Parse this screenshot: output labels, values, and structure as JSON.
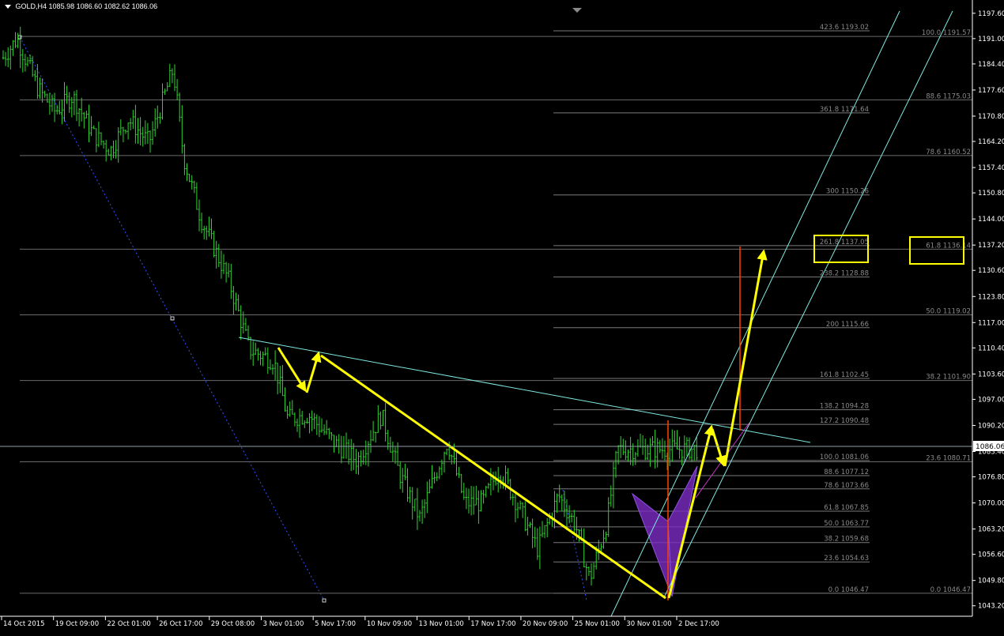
{
  "header": {
    "symbol": "GOLD,H4",
    "ohlc": "1085.98 1086.60 1082.62 1086.06"
  },
  "colors": {
    "background": "#000000",
    "candle_bar": "#2fd52f",
    "grid_level": "#8a8a8a",
    "channel": "#7fe8e0",
    "pattern_arrow": "#ffff00",
    "vertical_marker": "#ff4000",
    "magenta_line": "#cc33cc",
    "pattern_fill": "#7a2cc4",
    "highlight_box": "#ffff00",
    "blue_dotted": "#3050ff",
    "price_tag_bg": "#ffffff"
  },
  "chart_data": {
    "type": "ohlc",
    "symbol": "GOLD",
    "timeframe": "H4",
    "ylim": [
      1041.5,
      1199.0
    ],
    "current_price": 1086.06,
    "price_axis_ticks": [
      "1197.60",
      "1191.00",
      "1184.40",
      "1177.60",
      "1170.80",
      "1164.20",
      "1157.40",
      "1150.80",
      "1144.00",
      "1137.20",
      "1130.60",
      "1123.80",
      "1117.00",
      "1110.40",
      "1103.60",
      "1097.00",
      "1090.20",
      "1083.40",
      "1076.80",
      "1070.00",
      "1063.20",
      "1056.60",
      "1049.80",
      "1043.20"
    ],
    "time_axis_labels": [
      "14 Oct 2015",
      "19 Oct 09:00",
      "22 Oct 01:00",
      "26 Oct 17:00",
      "29 Oct 08:00",
      "3 Nov 01:00",
      "5 Nov 17:00",
      "10 Nov 09:00",
      "13 Nov 01:00",
      "17 Nov 17:00",
      "20 Nov 09:00",
      "25 Nov 01:00",
      "30 Nov 01:00",
      "2 Dec 17:00"
    ],
    "fib_extension_levels": [
      {
        "ratio": "423.6",
        "price": "1193.02"
      },
      {
        "ratio": "361.8",
        "price": "1171.64"
      },
      {
        "ratio": "300",
        "price": "1150.26"
      },
      {
        "ratio": "261.8",
        "price": "1137.05"
      },
      {
        "ratio": "238.2",
        "price": "1128.88"
      },
      {
        "ratio": "200",
        "price": "1115.66"
      },
      {
        "ratio": "161.8",
        "price": "1102.45"
      },
      {
        "ratio": "138.2",
        "price": "1094.28"
      },
      {
        "ratio": "127.2",
        "price": "1090.48"
      },
      {
        "ratio": "100.0",
        "price": "1081.06"
      },
      {
        "ratio": "88.6",
        "price": "1077.12"
      },
      {
        "ratio": "78.6",
        "price": "1073.66"
      },
      {
        "ratio": "61.8",
        "price": "1067.85"
      },
      {
        "ratio": "50.0",
        "price": "1063.77"
      },
      {
        "ratio": "38.2",
        "price": "1059.68"
      },
      {
        "ratio": "23.6",
        "price": "1054.63"
      },
      {
        "ratio": "0.0",
        "price": "1046.47"
      }
    ],
    "fib_retracement_levels": [
      {
        "ratio": "100.0",
        "price": "1191.57"
      },
      {
        "ratio": "88.6",
        "price": "1175.03"
      },
      {
        "ratio": "78.6",
        "price": "1160.52"
      },
      {
        "ratio": "61.8",
        "price": "1136.14"
      },
      {
        "ratio": "50.0",
        "price": "1119.02"
      },
      {
        "ratio": "38.2",
        "price": "1101.90"
      },
      {
        "ratio": "23.6",
        "price": "1080.71"
      },
      {
        "ratio": "0.0",
        "price": "1046.47"
      }
    ],
    "bar_series_anchors": [
      {
        "t": 0,
        "p": 1186
      },
      {
        "t": 0.02,
        "p": 1191
      },
      {
        "t": 0.05,
        "p": 1178
      },
      {
        "t": 0.075,
        "p": 1172
      },
      {
        "t": 0.1,
        "p": 1176
      },
      {
        "t": 0.13,
        "p": 1166
      },
      {
        "t": 0.155,
        "p": 1162
      },
      {
        "t": 0.18,
        "p": 1170
      },
      {
        "t": 0.21,
        "p": 1164
      },
      {
        "t": 0.245,
        "p": 1183
      },
      {
        "t": 0.26,
        "p": 1160
      },
      {
        "t": 0.285,
        "p": 1144
      },
      {
        "t": 0.325,
        "p": 1128
      },
      {
        "t": 0.355,
        "p": 1110
      },
      {
        "t": 0.39,
        "p": 1107
      },
      {
        "t": 0.41,
        "p": 1092
      },
      {
        "t": 0.44,
        "p": 1093
      },
      {
        "t": 0.475,
        "p": 1086
      },
      {
        "t": 0.51,
        "p": 1081
      },
      {
        "t": 0.545,
        "p": 1093
      },
      {
        "t": 0.57,
        "p": 1078
      },
      {
        "t": 0.6,
        "p": 1066
      },
      {
        "t": 0.64,
        "p": 1086
      },
      {
        "t": 0.665,
        "p": 1070
      },
      {
        "t": 0.69,
        "p": 1070
      },
      {
        "t": 0.715,
        "p": 1079
      },
      {
        "t": 0.74,
        "p": 1070
      },
      {
        "t": 0.77,
        "p": 1058
      },
      {
        "t": 0.8,
        "p": 1072
      },
      {
        "t": 0.825,
        "p": 1064
      },
      {
        "t": 0.845,
        "p": 1050
      },
      {
        "t": 0.87,
        "p": 1065
      },
      {
        "t": 0.885,
        "p": 1084
      }
    ]
  },
  "highlight_boxes": [
    {
      "label": "261.8 1137.05"
    },
    {
      "label": "61.8 1136.14"
    }
  ]
}
